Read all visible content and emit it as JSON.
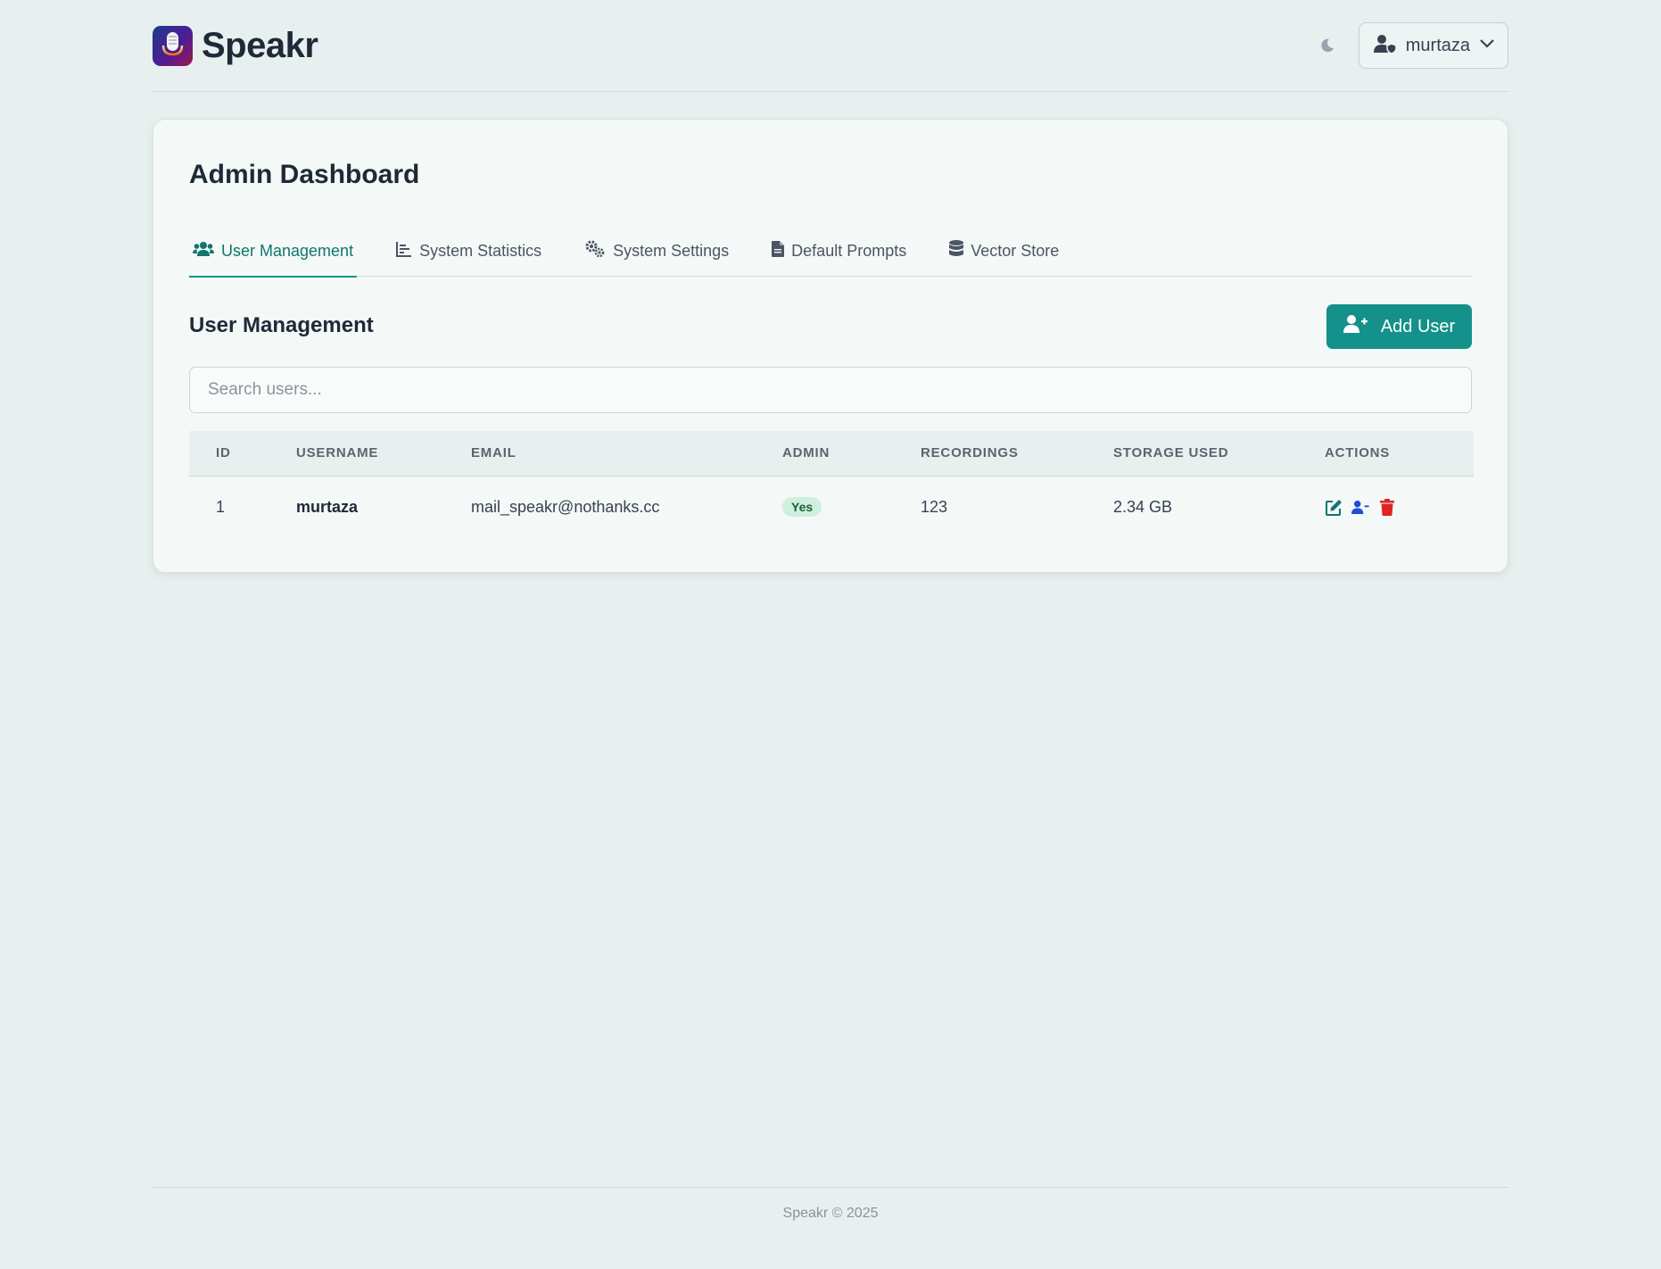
{
  "app": {
    "name": "Speakr",
    "accent": "#13918a"
  },
  "header": {
    "theme_icon": "moon-icon",
    "user_icon": "user-shield-icon",
    "username": "murtaza",
    "dropdown_icon": "chevron-down-icon"
  },
  "page": {
    "title": "Admin Dashboard"
  },
  "tabs": [
    {
      "label": "User Management",
      "icon": "users-icon",
      "active": true
    },
    {
      "label": "System Statistics",
      "icon": "chart-bar-icon",
      "active": false
    },
    {
      "label": "System Settings",
      "icon": "gears-icon",
      "active": false
    },
    {
      "label": "Default Prompts",
      "icon": "file-icon",
      "active": false
    },
    {
      "label": "Vector Store",
      "icon": "database-icon",
      "active": false
    }
  ],
  "section": {
    "title": "User Management",
    "add_button": "Add User",
    "search_placeholder": "Search users..."
  },
  "table": {
    "columns": [
      "ID",
      "USERNAME",
      "EMAIL",
      "ADMIN",
      "RECORDINGS",
      "STORAGE USED",
      "ACTIONS"
    ],
    "rows": [
      {
        "id": "1",
        "username": "murtaza",
        "email": "mail_speakr@nothanks.cc",
        "admin": "Yes",
        "recordings": "123",
        "storage": "2.34 GB"
      }
    ]
  },
  "footer": {
    "text": "Speakr © 2025"
  }
}
